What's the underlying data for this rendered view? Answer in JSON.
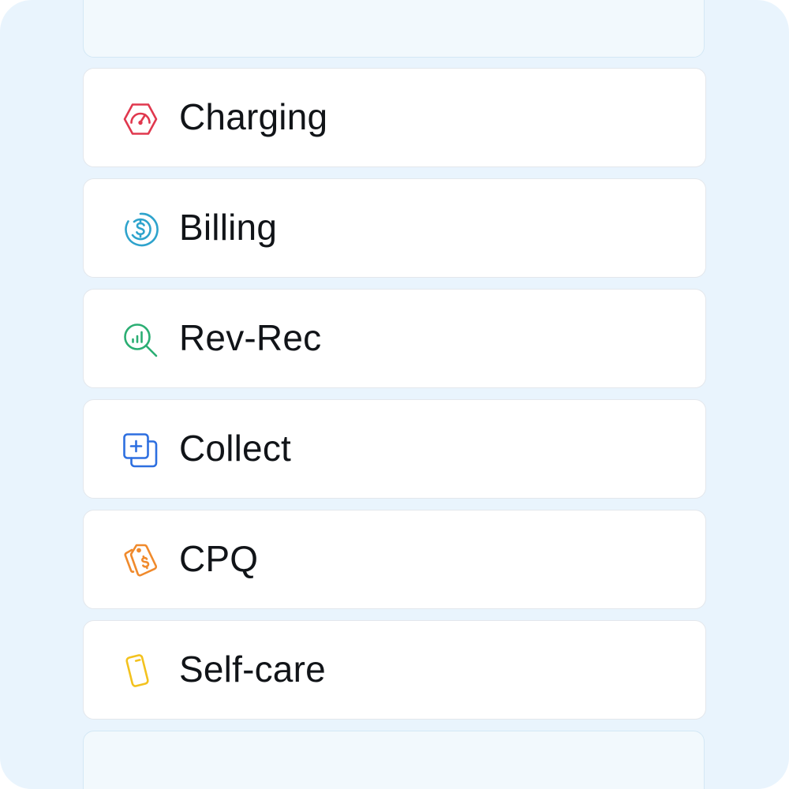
{
  "menu": {
    "items": [
      {
        "label": "Charging",
        "icon": "speedometer-hexagon-icon",
        "color": "#e0384e"
      },
      {
        "label": "Billing",
        "icon": "dollar-circle-icon",
        "color": "#2ea3cc"
      },
      {
        "label": "Rev-Rec",
        "icon": "chart-magnifier-icon",
        "color": "#2bae73"
      },
      {
        "label": "Collect",
        "icon": "stacked-squares-plus-icon",
        "color": "#2d6fe0"
      },
      {
        "label": "CPQ",
        "icon": "price-tags-icon",
        "color": "#f08a2c"
      },
      {
        "label": "Self-care",
        "icon": "mobile-phone-icon",
        "color": "#f3c21e"
      }
    ]
  },
  "colors": {
    "background": "#e9f4fd",
    "card": "#ffffff",
    "card_border": "#e3e7ec",
    "ghost_card": "#f2f9fd",
    "text": "#111418"
  }
}
